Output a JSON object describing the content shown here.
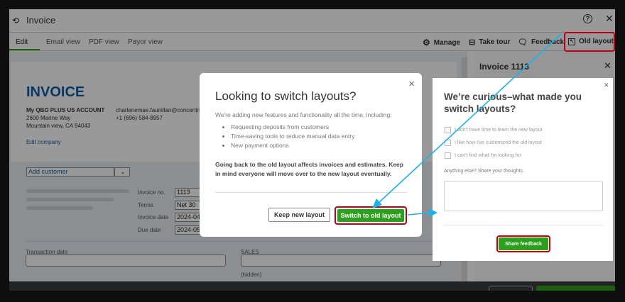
{
  "header": {
    "title": "Invoice",
    "help_icon": "help-circle-icon",
    "close_icon": "close-icon"
  },
  "tabs": [
    {
      "label": "Edit"
    },
    {
      "label": "Email view"
    },
    {
      "label": "PDF view"
    },
    {
      "label": "Payor view"
    }
  ],
  "toolbar": {
    "manage": "Manage",
    "take_tour": "Take tour",
    "feedback": "Feedback",
    "old_layout": "Old layout"
  },
  "invoice": {
    "heading": "INVOICE",
    "company": "My QBO PLUS US ACCOUNT",
    "address1": "2600 Marine Way",
    "address2": "Mountain view, CA 94043",
    "email": "charlenemae.faunillan@concentrix",
    "phone": "+1 (696) 584-8957",
    "edit_company": "Edit company",
    "customer_placeholder": "Add customer",
    "fields": [
      {
        "label": "Invoice no.",
        "value": "1113"
      },
      {
        "label": "Terms",
        "value": "Net 30"
      },
      {
        "label": "Invoice date",
        "value": "2024-04"
      },
      {
        "label": "Due date",
        "value": "2024-05"
      }
    ],
    "transaction_date": "Transaction date",
    "sales": "SALES",
    "hidden": "(hidden)"
  },
  "panel": {
    "title": "Invoice 1113"
  },
  "modal1": {
    "title": "Looking to switch layouts?",
    "intro": "We're adding new features and functionality all the time, including:",
    "bullets": [
      "Requesting deposits from customers",
      "Time-saving tools to reduce manual data entry",
      "New payment options"
    ],
    "warning": "Going back to the old layout affects invoices and estimates. Keep in mind everyone will move over to the new layout eventually.",
    "keep": "Keep new layout",
    "switch": "Switch to old layout"
  },
  "modal2": {
    "title": "We’re curious–what made you switch layouts?",
    "options": [
      "I don't have time to learn the new layout",
      "I like how I've customized the old layout",
      "I can't find what I'm looking for"
    ],
    "comment_label": "Anything else? Share your thoughts.",
    "submit": "Share feedback"
  },
  "colors": {
    "accent_green": "#2ca01c",
    "annotation_red": "#c00010",
    "arrow": "#19b2ea",
    "brand_blue": "#0d5fa8"
  }
}
